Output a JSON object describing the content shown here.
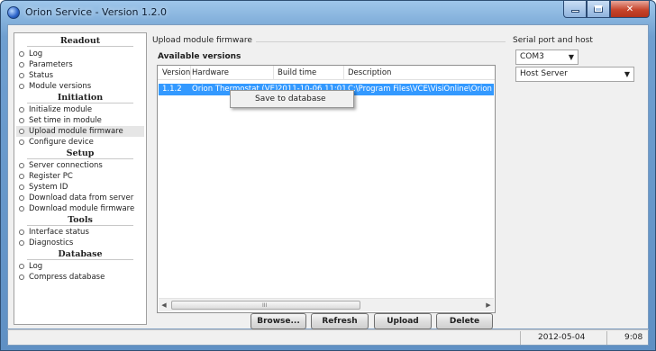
{
  "window": {
    "title": "Orion Service - Version 1.2.0",
    "caption_buttons": [
      "minimize-icon",
      "maximize-icon",
      "close-icon"
    ]
  },
  "sidebar": {
    "sections": [
      {
        "header": "Readout",
        "items": [
          "Log",
          "Parameters",
          "Status",
          "Module versions"
        ]
      },
      {
        "header": "Initiation",
        "items": [
          "Initialize module",
          "Set time in module",
          "Upload module firmware",
          "Configure device"
        ]
      },
      {
        "header": "Setup",
        "items": [
          "Server connections",
          "Register PC",
          "System ID",
          "Download data from server",
          "Download module firmware"
        ]
      },
      {
        "header": "Tools",
        "items": [
          "Interface status",
          "Diagnostics"
        ]
      },
      {
        "header": "Database",
        "items": [
          "Log",
          "Compress database"
        ]
      }
    ],
    "selected": "Upload module firmware"
  },
  "main": {
    "group_title": "Upload module firmware",
    "available_label": "Available versions",
    "columns": [
      "Version",
      "Hardware",
      "Build time",
      "Description"
    ],
    "rows": [
      {
        "version": "1.1.2",
        "hardware": "Orion Thermostat (VE)",
        "build_time": "2011-10-06 11:01",
        "description": "C:\\Program Files\\VCE\\VisiOnline\\Orion EMS"
      }
    ],
    "context_menu": {
      "items": [
        "Save to database"
      ]
    },
    "buttons": {
      "browse": "Browse...",
      "refresh": "Refresh",
      "upload": "Upload",
      "delete": "Delete"
    },
    "scrollbar": {
      "grip": "III"
    }
  },
  "serial": {
    "group_title": "Serial port and host",
    "port": "COM3",
    "host": "Host Server"
  },
  "statusbar": {
    "date": "2012-05-04",
    "time": "9:08"
  },
  "colors": {
    "selection": "#3399ff",
    "title_gradient_top": "#9ec6ea",
    "title_gradient_bottom": "#5f90c4",
    "close_button": "#c7452c"
  }
}
